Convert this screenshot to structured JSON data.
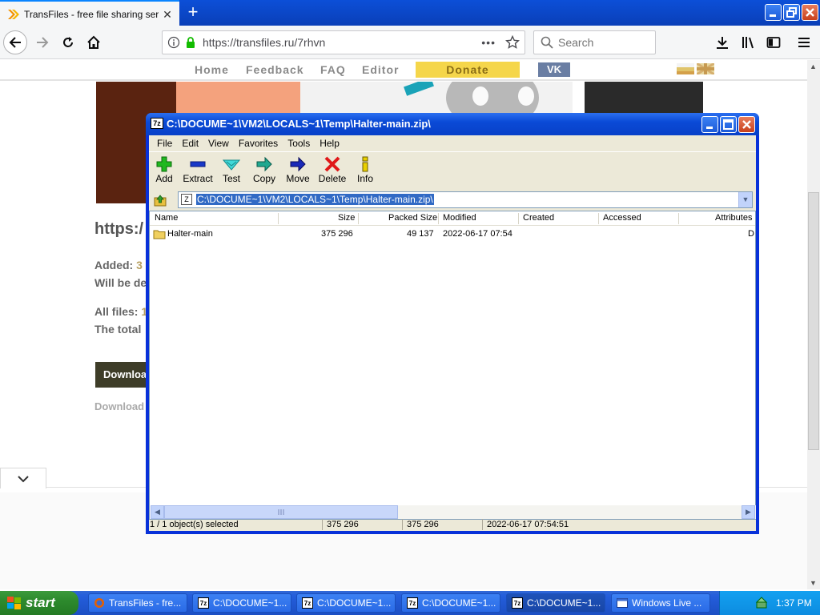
{
  "browser": {
    "tab_title": "TransFiles - free file sharing service",
    "new_tab": "+",
    "url": "https://transfiles.ru/7rhvn",
    "search_placeholder": "Search",
    "window_buttons": {
      "minimize": "_",
      "maximize": "□",
      "close": "✕"
    }
  },
  "site": {
    "nav": [
      "Home",
      "Feedback",
      "FAQ",
      "Editor"
    ],
    "donate": "Donate",
    "vk": "VK",
    "heading": "https:/",
    "added_label": "Added:",
    "added_value": "3",
    "deleted_line": "Will be de",
    "all_files_label": "All files:",
    "all_files_value": "1",
    "total_line": "The total",
    "download_button": "Downloa",
    "download_note": "Download"
  },
  "zip": {
    "title": "C:\\DOCUME~1\\VM2\\LOCALS~1\\Temp\\Halter-main.zip\\",
    "app_icon": "7z",
    "menu": [
      "File",
      "Edit",
      "View",
      "Favorites",
      "Tools",
      "Help"
    ],
    "toolbar": [
      "Add",
      "Extract",
      "Test",
      "Copy",
      "Move",
      "Delete",
      "Info"
    ],
    "address": "C:\\DOCUME~1\\VM2\\LOCALS~1\\Temp\\Halter-main.zip\\",
    "columns": [
      "Name",
      "Size",
      "Packed Size",
      "Modified",
      "Created",
      "Accessed",
      "Attributes"
    ],
    "rows": [
      {
        "name": "Halter-main",
        "size": "375 296",
        "packed": "49 137",
        "modified": "2022-06-17 07:54",
        "created": "",
        "accessed": "",
        "attributes": "D"
      }
    ],
    "status": {
      "selected": "1 / 1 object(s) selected",
      "size": "375 296",
      "packed": "375 296",
      "modified": "2022-06-17 07:54:51"
    },
    "colors": {
      "title_bar": "#0a4ad6",
      "selection": "#316ac5"
    }
  },
  "taskbar": {
    "start": "start",
    "buttons": [
      "TransFiles - fre...",
      "C:\\DOCUME~1...",
      "C:\\DOCUME~1...",
      "C:\\DOCUME~1...",
      "C:\\DOCUME~1...",
      "Windows Live ..."
    ],
    "active_index": 4,
    "clock": "1:37 PM"
  }
}
